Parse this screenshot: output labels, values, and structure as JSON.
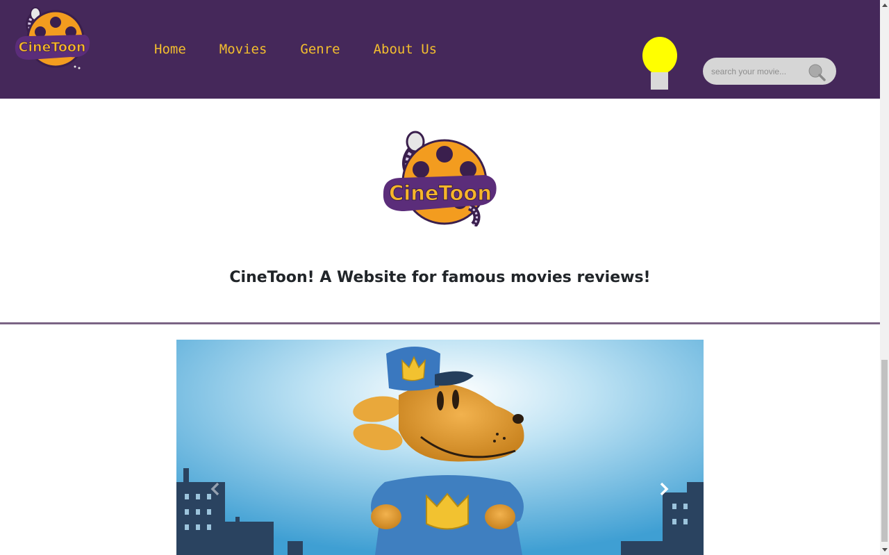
{
  "brand": {
    "logo_text_line1": "Cine",
    "logo_text_line2": "Toon",
    "colors": {
      "navbar": "#45285a",
      "nav_text": "#f3be2e",
      "reel": "#f39c1f",
      "bulb": "#ffff00"
    }
  },
  "nav": {
    "items": [
      {
        "label": "Home"
      },
      {
        "label": "Movies"
      },
      {
        "label": "Genre"
      },
      {
        "label": "About Us"
      }
    ]
  },
  "theme_toggle": {
    "icon": "lightbulb-icon"
  },
  "search": {
    "placeholder": "search your movie...",
    "value": "",
    "icon": "search-icon"
  },
  "hero": {
    "tagline": "CineToon! A Website for famous movies reviews!"
  },
  "carousel": {
    "slide_image": "cartoon-dog-police-officer",
    "prev_icon": "chevron-left-icon",
    "next_icon": "chevron-right-icon"
  }
}
